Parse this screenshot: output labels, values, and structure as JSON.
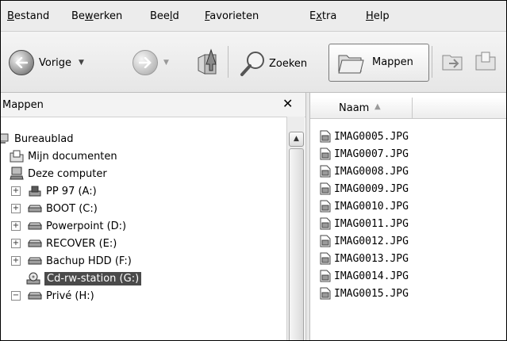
{
  "menu": [
    {
      "pre": "",
      "ul": "B",
      "post": "estand"
    },
    {
      "pre": "Be",
      "ul": "w",
      "post": "erken"
    },
    {
      "pre": "Bee",
      "ul": "l",
      "post": "d"
    },
    {
      "pre": "",
      "ul": "F",
      "post": "avorieten"
    },
    {
      "pre": "E",
      "ul": "x",
      "post": "tra"
    },
    {
      "pre": "",
      "ul": "H",
      "post": "elp"
    }
  ],
  "toolbar": {
    "back_label": "Vorige",
    "search_label": "Zoeken",
    "folders_label": "Mappen"
  },
  "folders_pane": {
    "title": "Mappen",
    "close_glyph": "✕",
    "tree": [
      {
        "label": "Bureaublad",
        "expander": "",
        "icon": "desktop-icon"
      },
      {
        "label": "Mijn documenten",
        "expander": "",
        "icon": "documents-icon"
      },
      {
        "label": "Deze computer",
        "expander": "",
        "icon": "computer-icon"
      },
      {
        "label": "PP 97 (A:)",
        "expander": "+",
        "icon": "floppy-drive-icon"
      },
      {
        "label": "BOOT (C:)",
        "expander": "+",
        "icon": "hard-drive-icon"
      },
      {
        "label": "Powerpoint (D:)",
        "expander": "+",
        "icon": "hard-drive-icon"
      },
      {
        "label": "RECOVER (E:)",
        "expander": "+",
        "icon": "hard-drive-icon"
      },
      {
        "label": "Bachup HDD (F:)",
        "expander": "+",
        "icon": "hard-drive-icon"
      },
      {
        "label": "Cd-rw-station (G:)",
        "expander": "",
        "icon": "cd-drive-icon",
        "selected": true
      },
      {
        "label": "Privé (H:)",
        "expander": "−",
        "icon": "hard-drive-icon"
      }
    ]
  },
  "file_list": {
    "column_name": "Naam",
    "sort_indicator": "▲",
    "files": [
      "IMAG0005.JPG",
      "IMAG0007.JPG",
      "IMAG0008.JPG",
      "IMAG0009.JPG",
      "IMAG0010.JPG",
      "IMAG0011.JPG",
      "IMAG0012.JPG",
      "IMAG0013.JPG",
      "IMAG0014.JPG",
      "IMAG0015.JPG"
    ]
  }
}
